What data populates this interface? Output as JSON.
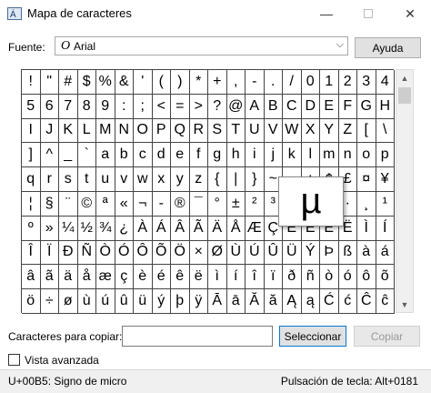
{
  "window": {
    "title": "Mapa de caracteres",
    "minimize_glyph": "—",
    "close_glyph": "✕"
  },
  "font": {
    "label": "Fuente:",
    "icon_glyph": "O",
    "selected": "Arial",
    "chevron_glyph": "⌵"
  },
  "buttons": {
    "help": "Ayuda",
    "select": "Seleccionar",
    "copy": "Copiar"
  },
  "grid": {
    "rows": [
      [
        "!",
        "\"",
        "#",
        "$",
        "%",
        "&",
        "'",
        "(",
        ")",
        "*",
        "+",
        ",",
        "-",
        ".",
        "/",
        "0",
        "1",
        "2",
        "3",
        "4"
      ],
      [
        "5",
        "6",
        "7",
        "8",
        "9",
        ":",
        ";",
        "<",
        "=",
        ">",
        "?",
        "@",
        "A",
        "B",
        "C",
        "D",
        "E",
        "F",
        "G",
        "H"
      ],
      [
        "I",
        "J",
        "K",
        "L",
        "M",
        "N",
        "O",
        "P",
        "Q",
        "R",
        "S",
        "T",
        "U",
        "V",
        "W",
        "X",
        "Y",
        "Z",
        "[",
        "\\"
      ],
      [
        "]",
        "^",
        "_",
        "`",
        "a",
        "b",
        "c",
        "d",
        "e",
        "f",
        "g",
        "h",
        "i",
        "j",
        "k",
        "l",
        "m",
        "n",
        "o",
        "p"
      ],
      [
        "q",
        "r",
        "s",
        "t",
        "u",
        "v",
        "w",
        "x",
        "y",
        "z",
        "{",
        "|",
        "}",
        "~",
        "",
        "¡",
        "¢",
        "£",
        "¤",
        "¥"
      ],
      [
        "¦",
        "§",
        "¨",
        "©",
        "ª",
        "«",
        "¬",
        "-",
        "®",
        "¯",
        "°",
        "±",
        "²",
        "³",
        "´",
        "µ",
        "¶",
        "·",
        "¸",
        "¹"
      ],
      [
        "º",
        "»",
        "¼",
        "½",
        "¾",
        "¿",
        "À",
        "Á",
        "Â",
        "Ã",
        "Ä",
        "Å",
        "Æ",
        "Ç",
        "È",
        "É",
        "Ê",
        "Ë",
        "Ì",
        "Í"
      ],
      [
        "Î",
        "Ï",
        "Ð",
        "Ñ",
        "Ò",
        "Ó",
        "Ô",
        "Õ",
        "Ö",
        "×",
        "Ø",
        "Ù",
        "Ú",
        "Û",
        "Ü",
        "Ý",
        "Þ",
        "ß",
        "à",
        "á"
      ],
      [
        "â",
        "ã",
        "ä",
        "å",
        "æ",
        "ç",
        "è",
        "é",
        "ê",
        "ë",
        "ì",
        "í",
        "î",
        "ï",
        "ð",
        "ñ",
        "ò",
        "ó",
        "ô",
        "õ"
      ],
      [
        "ö",
        "÷",
        "ø",
        "ù",
        "ú",
        "û",
        "ü",
        "ý",
        "þ",
        "ÿ",
        "Ā",
        "ā",
        "Ă",
        "ă",
        "Ą",
        "ą",
        "Ć",
        "ć",
        "Ĉ",
        "ĉ"
      ]
    ],
    "zoomed_char": "µ"
  },
  "scrollbar": {
    "up_glyph": "▲",
    "down_glyph": "▼"
  },
  "copy": {
    "label": "Caracteres para copiar:",
    "value": ""
  },
  "advanced": {
    "label": "Vista avanzada",
    "checked": false
  },
  "status": {
    "left": "U+00B5: Signo de micro",
    "right": "Pulsación de tecla: Alt+0181"
  }
}
